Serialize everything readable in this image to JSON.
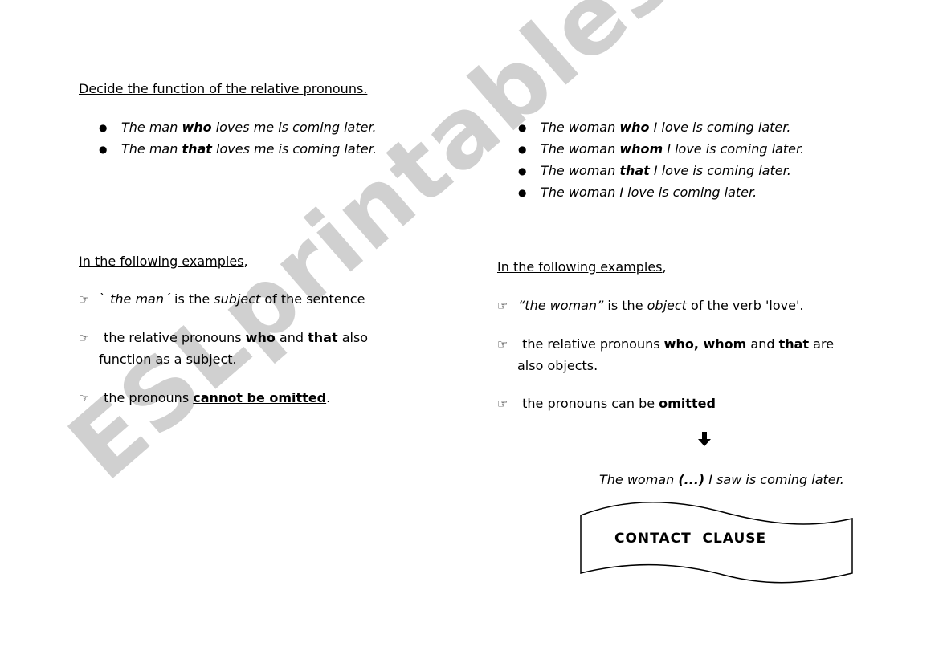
{
  "watermark": "ESLprintables.com",
  "title": "Decide the function of the relative pronouns.",
  "left_examples": [
    [
      {
        "t": "The man ",
        "s": "i"
      },
      {
        "t": "who",
        "s": "i b"
      },
      {
        "t": " loves me is coming later.",
        "s": "i"
      }
    ],
    [
      {
        "t": "The man ",
        "s": "i"
      },
      {
        "t": "that",
        "s": "i b"
      },
      {
        "t": " loves me is coming later.",
        "s": "i"
      }
    ]
  ],
  "right_examples": [
    [
      {
        "t": "The woman ",
        "s": "i"
      },
      {
        "t": "who",
        "s": "i b"
      },
      {
        "t": " I love is coming later.",
        "s": "i"
      }
    ],
    [
      {
        "t": "The woman ",
        "s": "i"
      },
      {
        "t": "whom",
        "s": "i b"
      },
      {
        "t": " I love is coming later.",
        "s": "i"
      }
    ],
    [
      {
        "t": "The woman ",
        "s": "i"
      },
      {
        "t": "that",
        "s": "i b"
      },
      {
        "t": " I love is coming later.",
        "s": "i"
      }
    ],
    [
      {
        "t": "The woman I love is coming later.",
        "s": "i"
      }
    ]
  ],
  "left_heading": [
    {
      "t": "In the following examples",
      "s": "u"
    },
    {
      "t": ",",
      "s": ""
    }
  ],
  "right_heading": [
    {
      "t": "In the following examples",
      "s": "u"
    },
    {
      "t": ",",
      "s": ""
    }
  ],
  "bullet_icon": "pointing-hand-icon",
  "left_points": [
    [
      {
        "t": "` ",
        "s": ""
      },
      {
        "t": "the man´",
        "s": "i"
      },
      {
        "t": " is the ",
        "s": ""
      },
      {
        "t": "subject",
        "s": "i"
      },
      {
        "t": " of the sentence",
        "s": ""
      }
    ],
    [
      {
        "t": " the relative pronouns ",
        "s": ""
      },
      {
        "t": "who",
        "s": "b"
      },
      {
        "t": " and ",
        "s": ""
      },
      {
        "t": "that",
        "s": "b"
      },
      {
        "t": " also",
        "s": ""
      }
    ],
    [
      {
        "t": "function  as a subject.",
        "s": ""
      }
    ],
    [
      {
        "t": " the pronouns ",
        "s": ""
      },
      {
        "t": "cannot be omitted",
        "s": "b u"
      },
      {
        "t": ".",
        "s": ""
      }
    ]
  ],
  "right_points": [
    [
      {
        "t": "“the woman”",
        "s": "i"
      },
      {
        "t": " is the ",
        "s": ""
      },
      {
        "t": "object",
        "s": "i"
      },
      {
        "t": " of the verb 'love'.",
        "s": ""
      }
    ],
    [
      {
        "t": " the relative pronouns ",
        "s": ""
      },
      {
        "t": "who, whom",
        "s": "b"
      },
      {
        "t": " and ",
        "s": ""
      },
      {
        "t": "that",
        "s": "b"
      },
      {
        "t": " are",
        "s": ""
      }
    ],
    [
      {
        "t": "also objects.",
        "s": ""
      }
    ],
    [
      {
        "t": " the ",
        "s": ""
      },
      {
        "t": "pronouns",
        "s": "u"
      },
      {
        "t": " can be ",
        "s": ""
      },
      {
        "t": "omitted",
        "s": "b u"
      }
    ]
  ],
  "example_sentence": [
    {
      "t": "The woman ",
      "s": "i"
    },
    {
      "t": "(...)",
      "s": "i b"
    },
    {
      "t": " I saw is coming later.",
      "s": "i"
    }
  ],
  "banner_label": "CONTACT  CLAUSE"
}
